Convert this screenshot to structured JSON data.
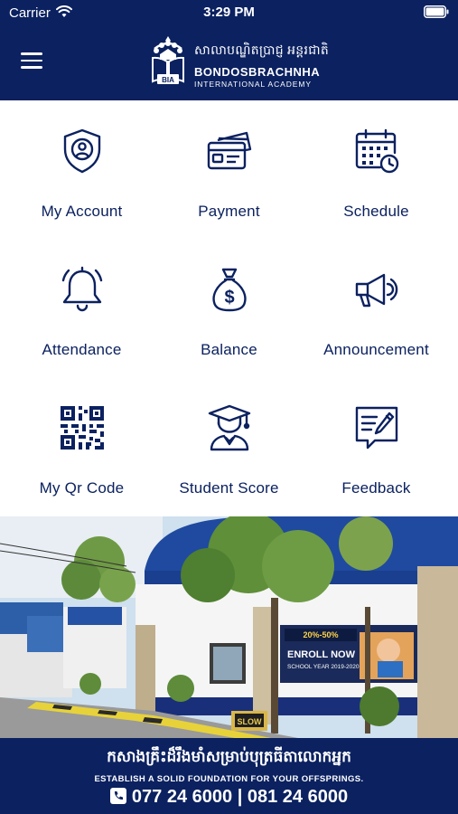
{
  "status_bar": {
    "carrier": "Carrier",
    "time": "3:29 PM",
    "icons": [
      "wifi-icon",
      "battery-icon"
    ]
  },
  "header": {
    "menu_icon": "hamburger-menu-icon",
    "logo": {
      "khmer_name": "សាលាបណ្ឌិតប្រាជ្ញ អន្តរជាតិ",
      "name": "BONDOSBRACHNHA",
      "subtitle": "INTERNATIONAL ACADEMY",
      "emblem_text": "BIA"
    },
    "background_color": "#0b2160"
  },
  "menu": {
    "items": [
      {
        "label": "My Account",
        "icon": "user-shield-icon"
      },
      {
        "label": "Payment",
        "icon": "credit-card-icon"
      },
      {
        "label": "Schedule",
        "icon": "calendar-clock-icon"
      },
      {
        "label": "Attendance",
        "icon": "bell-icon"
      },
      {
        "label": "Balance",
        "icon": "money-bag-icon"
      },
      {
        "label": "Announcement",
        "icon": "megaphone-icon"
      },
      {
        "label": "My Qr Code",
        "icon": "qr-code-icon"
      },
      {
        "label": "Student Score",
        "icon": "graduate-icon"
      },
      {
        "label": "Feedback",
        "icon": "feedback-form-icon"
      }
    ],
    "accent_color": "#0b2160"
  },
  "banner": {
    "poster_discount": "20%-50%",
    "poster_title": "ENROLL NOW",
    "poster_subtitle": "SCHOOL YEAR 2019-2020",
    "sign_text": "SLOW"
  },
  "footer": {
    "khmer_slogan": "កសាងគ្រឹះដ៏រឹងមាំសម្រាប់បុត្រធីតាលោកអ្នក",
    "slogan": "ESTABLISH A SOLID FOUNDATION FOR YOUR OFFSPRINGS.",
    "phone": "077 24 6000 | 081 24 6000",
    "phone_icon": "phone-icon"
  }
}
